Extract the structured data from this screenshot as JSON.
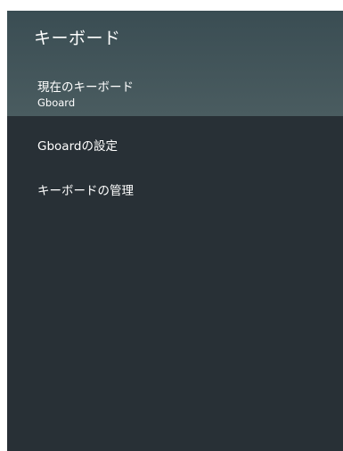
{
  "header": {
    "title": "キーボード"
  },
  "items": [
    {
      "label": "現在のキーボード",
      "subtitle": "Gboard"
    },
    {
      "label": "Gboardの設定"
    },
    {
      "label": "キーボードの管理"
    }
  ]
}
